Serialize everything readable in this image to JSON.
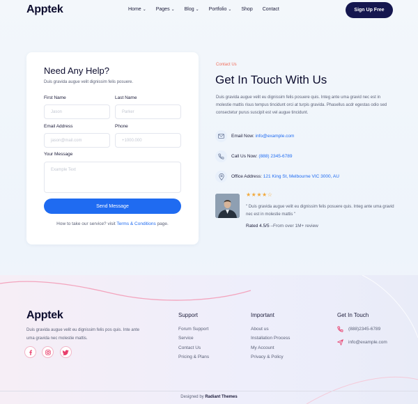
{
  "header": {
    "logo": "Apptek",
    "nav": [
      {
        "label": "Home",
        "dropdown": true
      },
      {
        "label": "Pages",
        "dropdown": true
      },
      {
        "label": "Blog",
        "dropdown": true
      },
      {
        "label": "Portfolio",
        "dropdown": true
      },
      {
        "label": "Shop",
        "dropdown": false
      },
      {
        "label": "Contact",
        "dropdown": false
      }
    ],
    "cta": "Sign Up Free"
  },
  "form": {
    "title": "Need Any Help?",
    "subtitle": "Duis gravida augue velit dignissim felis posuere.",
    "first_name_label": "First Name",
    "first_name_placeholder": "Jason",
    "last_name_label": "Last Name",
    "last_name_placeholder": "Parker",
    "email_label": "Email Address",
    "email_placeholder": "jason@mail.com",
    "phone_label": "Phone",
    "phone_placeholder": "+1000.000",
    "message_label": "Your Message",
    "message_placeholder": "Example Text",
    "send_label": "Send Message",
    "terms_prefix": "How to take our service? visit",
    "terms_link": "Terms & Conditions",
    "terms_suffix": "page."
  },
  "contact": {
    "eyebrow": "Contact Us",
    "title": "Get In Touch With Us",
    "description": "Duis gravida augue velit eu dignissim felis posuere quis. Integ ante uma gravid nec est in molestie mattis risus tempus tincidunt orci at turpis gravida. Phasellus acdr egestas odio sed consectetur purus suscipit est vel augue tincidunt.",
    "email_label": "Email Now:",
    "email_value": "info@example.com",
    "phone_label": "Call Us Now:",
    "phone_value": "(888) 2345-6789",
    "address_label": "Office Address:",
    "address_value": "121 King St, Melbourne VIC 3000, AU",
    "stars": "★★★★☆",
    "quote": "\" Duis gravida augue velit eu dignissim felis posuere quis. Integ ante uma gravid nec est in molestie mattis \"",
    "rating_strong": "Rated 4.5/5",
    "rating_rest": "–From over 1M+ review"
  },
  "footer": {
    "logo": "Apptek",
    "description": "Duis gravida augue velit eu dignissim felis pos quis. Inte ante uma gravida nec molestie mattis.",
    "social": [
      "facebook-icon",
      "instagram-icon",
      "twitter-icon"
    ],
    "support_heading": "Support",
    "support_links": [
      "Forum Support",
      "Service",
      "Contact Us",
      "Pricing & Plans"
    ],
    "important_heading": "Important",
    "important_links": [
      "About us",
      "Installation Process",
      "My Account",
      "Privacy & Policy"
    ],
    "touch_heading": "Get In Touch",
    "touch_phone": "(888)2345-6789",
    "touch_email": "info@example.com",
    "credit_prefix": "Designed by",
    "credit_name": "Radiant Themes"
  },
  "colors": {
    "brand_dark": "#15174f",
    "accent_blue": "#1f6bf1",
    "accent_coral": "#f06d5b",
    "star": "#f2a93b"
  }
}
